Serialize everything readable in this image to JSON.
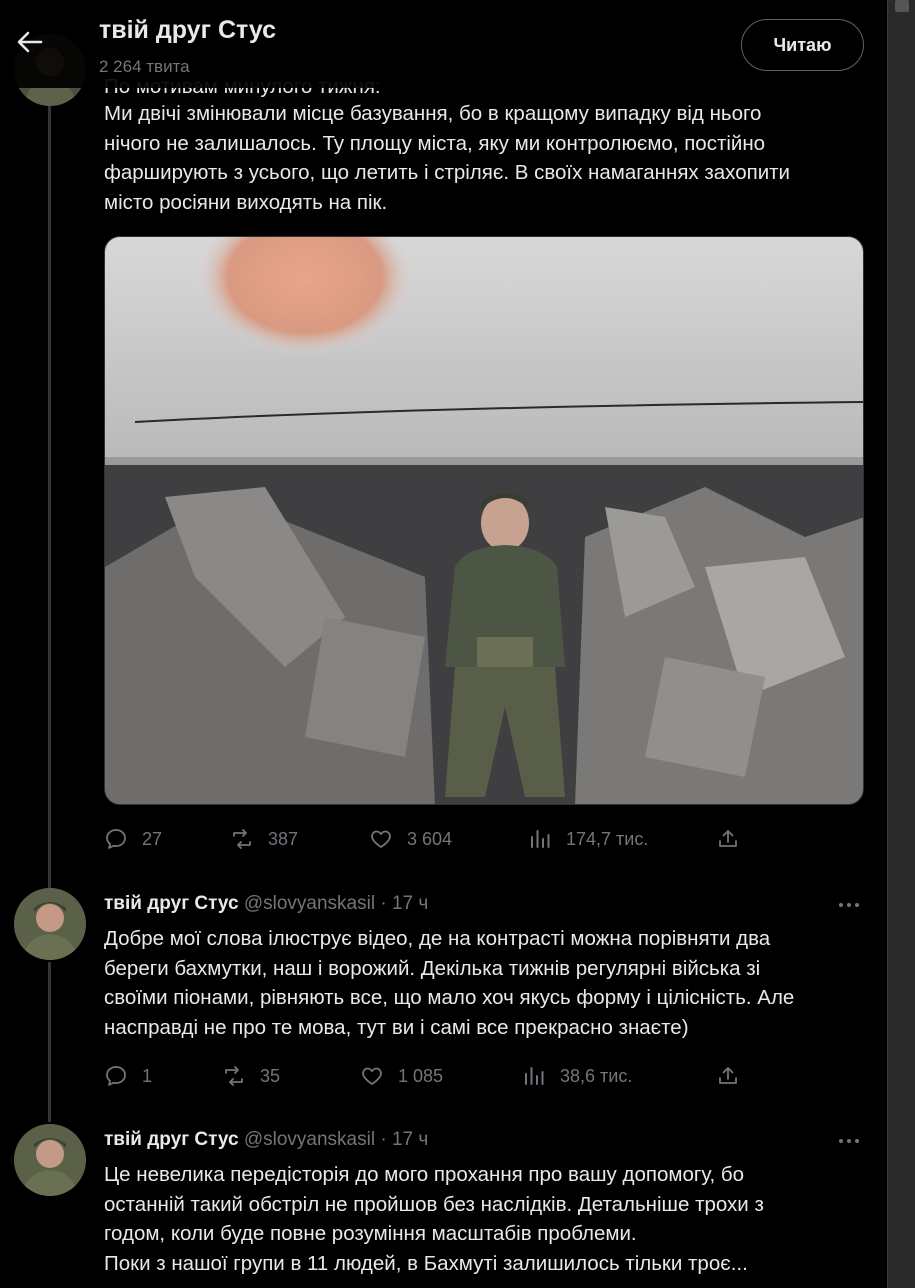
{
  "header": {
    "title": "твій друг Стус",
    "tweet_count": "2 264 твита",
    "follow_label": "Читаю"
  },
  "tweets": [
    {
      "text_partial_top": "По мотивам минулого тижня:",
      "text": "Ми двічі змінювали місце базування, бо в кращому випадку від нього\nнічого не залишалось. Ту площу міста, яку ми контролюємо, постійно\nфарширують з усього, що летить і стріляє. В своїх намаганнях захопити\nмісто росіяни виходять на пік.",
      "stats": {
        "replies": "27",
        "retweets": "387",
        "likes": "3 604",
        "views": "174,7 тис."
      }
    },
    {
      "name": "твій друг Стус",
      "handle": "@slovyanskasil · 17 ч",
      "text": "Добре мої слова ілюструє відео, де на контрасті можна порівняти два\nбереги бахмутки, наш і ворожий. Декілька тижнів регулярні війська зі\nсвоїми піонами, рівняють все, що   мало хоч якусь форму і цілісність. Але\nнасправді не про те мова, тут ви і самі все прекрасно знаєте)",
      "stats": {
        "replies": "1",
        "retweets": "35",
        "likes": "1 085",
        "views": "38,6 тис."
      }
    },
    {
      "name": "твій друг Стус",
      "handle": "@slovyanskasil · 17 ч",
      "text": "Це невелика передісторія до мого прохання про вашу допомогу, бо\nостанній такий обстріл не пройшов без наслідків. Детальніше трохи з\nгодом, коли буде повне розуміння масштабів проблеми.\nПоки з нашої групи в 11 людей, в Бахмуті залишилось тільки троє..."
    }
  ],
  "colors": {
    "background": "#000000",
    "text": "#e7e9ea",
    "muted": "#71767b",
    "border": "#2f3336"
  }
}
